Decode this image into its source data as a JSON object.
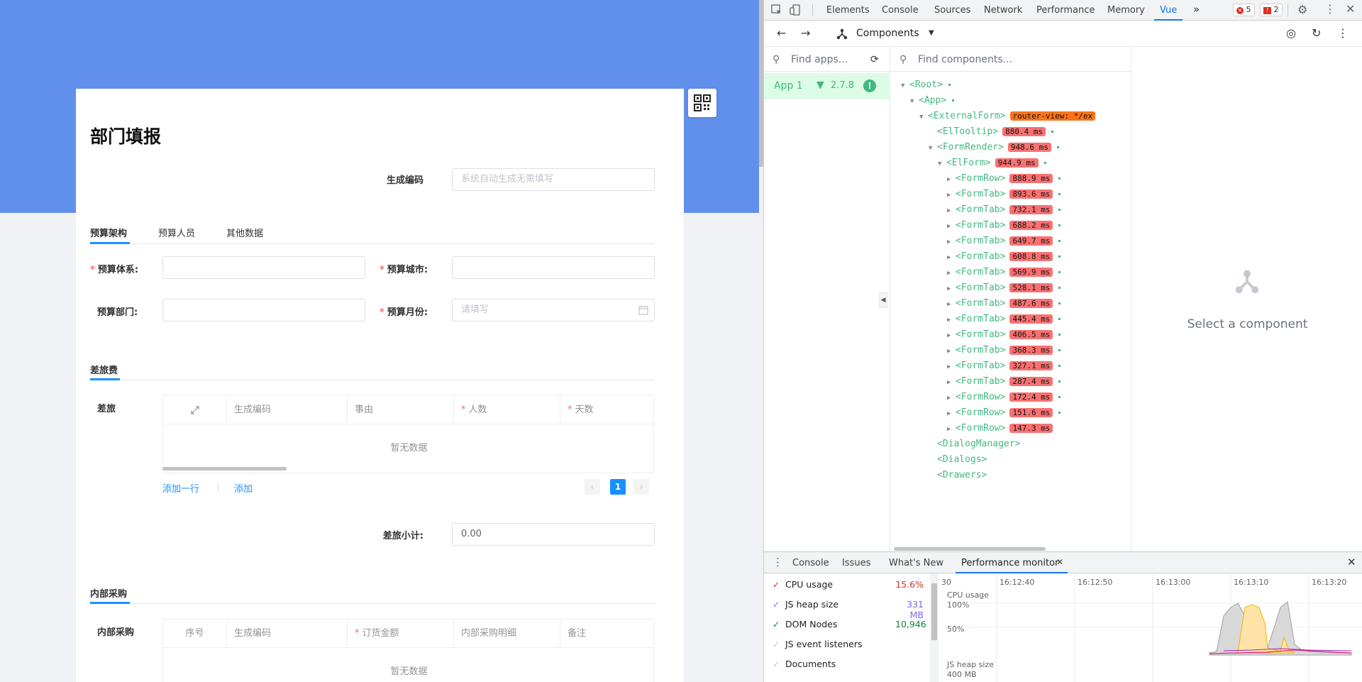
{
  "form": {
    "title": "部门填报",
    "code_label": "生成编码",
    "code_placeholder": "系统自动生成无需填写",
    "tabs": [
      "预算架构",
      "预算人员",
      "其他数据"
    ],
    "fields": {
      "system_label": "预算体系:",
      "city_label": "预算城市:",
      "dept_label": "预算部门:",
      "month_label": "预算月份:",
      "month_placeholder": "请填写"
    },
    "travel": {
      "section_title": "差旅费",
      "table_label": "差旅",
      "columns": [
        "生成编码",
        "事由",
        "人数",
        "天数"
      ],
      "empty": "暂无数据",
      "add_row": "添加一行",
      "add": "添加",
      "page": "1",
      "subtotal_label": "差旅小计:",
      "subtotal_value": "0.00"
    },
    "purchase": {
      "section_title": "内部采购",
      "table_label": "内部采购",
      "columns": [
        "序号",
        "生成编码",
        "订货金额",
        "内部采购明细",
        "备注"
      ],
      "empty": "暂无数据"
    }
  },
  "devtools": {
    "tabs": [
      "Elements",
      "Console",
      "Sources",
      "Network",
      "Performance",
      "Memory",
      "Vue"
    ],
    "more": "»",
    "errors": "5",
    "warnings": "2",
    "panel_title": "Components",
    "find_apps": "Find apps...",
    "find_components": "Find components...",
    "app_name": "App 1",
    "vue_version": "2.7.8",
    "select_component": "Select a component",
    "tree": [
      {
        "name": "<Root>",
        "depth": 0,
        "open": true,
        "ms": ""
      },
      {
        "name": "<App>",
        "depth": 1,
        "open": true,
        "ms": ""
      },
      {
        "name": "<ExternalForm>",
        "depth": 2,
        "open": true,
        "ms": "",
        "tag": "router-view: */ex"
      },
      {
        "name": "<ElTooltip>",
        "depth": 3,
        "open": null,
        "ms": "880.4 ms"
      },
      {
        "name": "<FormRender>",
        "depth": 3,
        "open": true,
        "ms": "948.6 ms"
      },
      {
        "name": "<ElForm>",
        "depth": 4,
        "open": true,
        "ms": "944.9 ms"
      },
      {
        "name": "<FormRow>",
        "depth": 5,
        "open": false,
        "ms": "888.9 ms"
      },
      {
        "name": "<FormTab>",
        "depth": 5,
        "open": false,
        "ms": "893.6 ms"
      },
      {
        "name": "<FormTab>",
        "depth": 5,
        "open": false,
        "ms": "732.1 ms"
      },
      {
        "name": "<FormTab>",
        "depth": 5,
        "open": false,
        "ms": "688.2 ms"
      },
      {
        "name": "<FormTab>",
        "depth": 5,
        "open": false,
        "ms": "649.7 ms"
      },
      {
        "name": "<FormTab>",
        "depth": 5,
        "open": false,
        "ms": "608.8 ms"
      },
      {
        "name": "<FormTab>",
        "depth": 5,
        "open": false,
        "ms": "569.9 ms"
      },
      {
        "name": "<FormTab>",
        "depth": 5,
        "open": false,
        "ms": "528.1 ms"
      },
      {
        "name": "<FormTab>",
        "depth": 5,
        "open": false,
        "ms": "487.6 ms"
      },
      {
        "name": "<FormTab>",
        "depth": 5,
        "open": false,
        "ms": "445.4 ms"
      },
      {
        "name": "<FormTab>",
        "depth": 5,
        "open": false,
        "ms": "406.5 ms"
      },
      {
        "name": "<FormTab>",
        "depth": 5,
        "open": false,
        "ms": "368.3 ms"
      },
      {
        "name": "<FormTab>",
        "depth": 5,
        "open": false,
        "ms": "327.1 ms"
      },
      {
        "name": "<FormTab>",
        "depth": 5,
        "open": false,
        "ms": "287.4 ms"
      },
      {
        "name": "<FormRow>",
        "depth": 5,
        "open": false,
        "ms": "172.4 ms"
      },
      {
        "name": "<FormRow>",
        "depth": 5,
        "open": false,
        "ms": "151.6 ms"
      },
      {
        "name": "<FormRow>",
        "depth": 5,
        "open": false,
        "ms": "147.3 ms"
      },
      {
        "name": "<DialogManager>",
        "depth": 3,
        "open": null,
        "ms": ""
      },
      {
        "name": "<Dialogs>",
        "depth": 3,
        "open": null,
        "ms": ""
      },
      {
        "name": "<Drawers>",
        "depth": 3,
        "open": null,
        "ms": ""
      }
    ],
    "drawer_tabs": [
      "Console",
      "Issues",
      "What's New",
      "Performance monitor"
    ],
    "metrics": [
      {
        "label": "CPU usage",
        "value": "15.6%",
        "checked": true,
        "color": "#d93025"
      },
      {
        "label": "JS heap size",
        "value": "331 MB",
        "checked": true,
        "color": "#7b68ee"
      },
      {
        "label": "DOM Nodes",
        "value": "10,946",
        "checked": true,
        "color": "#188038"
      },
      {
        "label": "JS event listeners",
        "value": "",
        "checked": false,
        "color": "#9aa0a6"
      },
      {
        "label": "Documents",
        "value": "",
        "checked": false,
        "color": "#9aa0a6"
      }
    ],
    "time_ticks": [
      "30",
      "16:12:40",
      "16:12:50",
      "16:13:00",
      "16:13:10",
      "16:13:20"
    ],
    "chart_labels": {
      "cpu": "CPU usage",
      "cpu_100": "100%",
      "cpu_50": "50%",
      "heap": "JS heap size",
      "heap_400": "400 MB"
    }
  }
}
